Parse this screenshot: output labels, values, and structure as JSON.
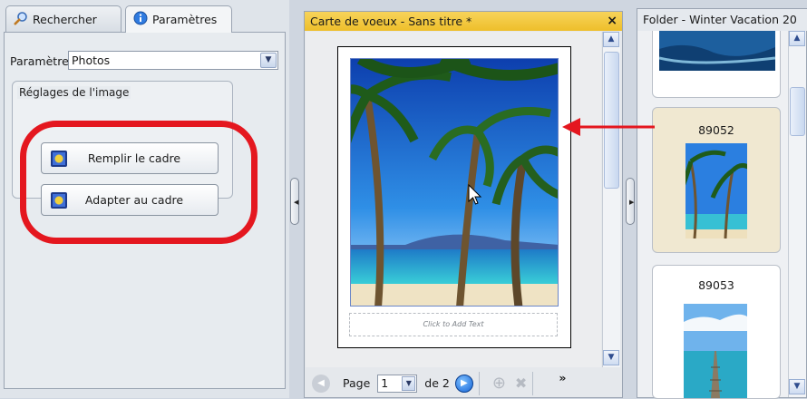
{
  "left_panel": {
    "tabs": [
      {
        "label": "Rechercher",
        "icon": "magnifier-icon",
        "active": false
      },
      {
        "label": "Paramètres",
        "icon": "info-icon",
        "active": true
      }
    ],
    "params_label": "Paramètres :",
    "params_select_value": "Photos",
    "group_title": "Réglages de l'image",
    "buttons": {
      "fill": "Remplir le cadre",
      "fit": "Adapter au cadre"
    },
    "highlight_color": "#e4171f"
  },
  "center_panel": {
    "title": "Carte de voeux - Sans titre *",
    "close_glyph": "×",
    "text_placeholder": "Click to Add Text",
    "pager": {
      "page_label": "Page",
      "page_value": "1",
      "of_label": "de 2",
      "more_glyph": "»"
    }
  },
  "right_panel": {
    "title": "Folder - Winter Vacation 20",
    "items": [
      {
        "id": "",
        "selected": false
      },
      {
        "id": "89052",
        "selected": true
      },
      {
        "id": "89053",
        "selected": false
      }
    ]
  },
  "colors": {
    "title_bar": "#f0c53a",
    "selection": "#f0e8d1",
    "accent_blue": "#1463d6"
  }
}
